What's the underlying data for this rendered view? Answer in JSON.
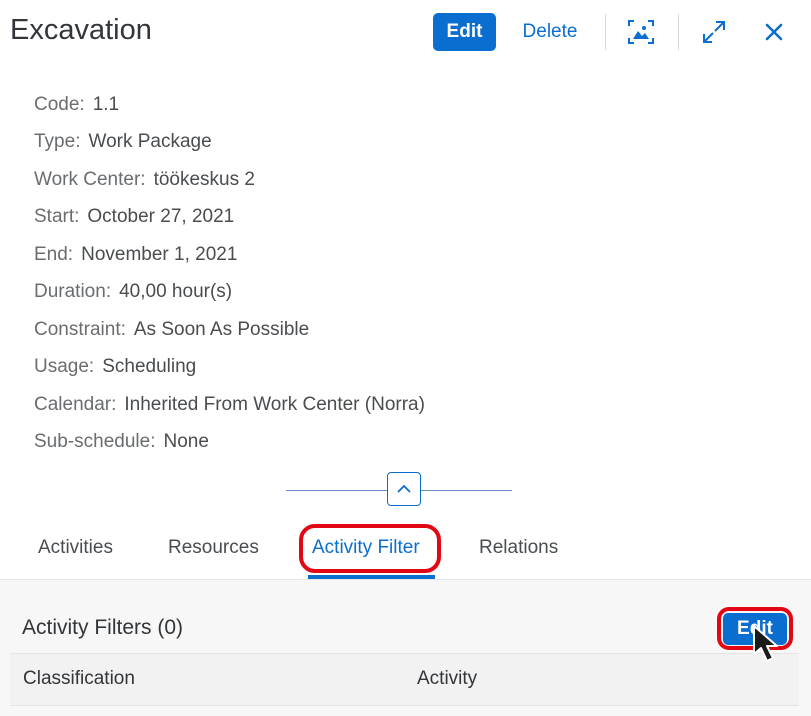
{
  "header": {
    "title": "Excavation",
    "edit_label": "Edit",
    "delete_label": "Delete"
  },
  "details": [
    {
      "label": "Code:",
      "value": "1.1"
    },
    {
      "label": "Type:",
      "value": "Work Package"
    },
    {
      "label": "Work Center:",
      "value": "töökeskus 2"
    },
    {
      "label": "Start:",
      "value": "October 27, 2021"
    },
    {
      "label": "End:",
      "value": "November 1, 2021"
    },
    {
      "label": "Duration:",
      "value": "40,00 hour(s)"
    },
    {
      "label": "Constraint:",
      "value": "As Soon As Possible"
    },
    {
      "label": "Usage:",
      "value": "Scheduling"
    },
    {
      "label": "Calendar:",
      "value": "Inherited From Work Center (Norra)"
    },
    {
      "label": "Sub-schedule:",
      "value": "None"
    }
  ],
  "tabs": [
    {
      "label": "Activities"
    },
    {
      "label": "Resources"
    },
    {
      "label": "Activity Filter"
    },
    {
      "label": "Relations"
    }
  ],
  "panel": {
    "title": "Activity Filters (0)",
    "edit_label": "Edit",
    "columns": [
      "Classification",
      "Activity"
    ]
  },
  "colors": {
    "accent": "#0a6ed1",
    "highlight": "#e30613"
  }
}
